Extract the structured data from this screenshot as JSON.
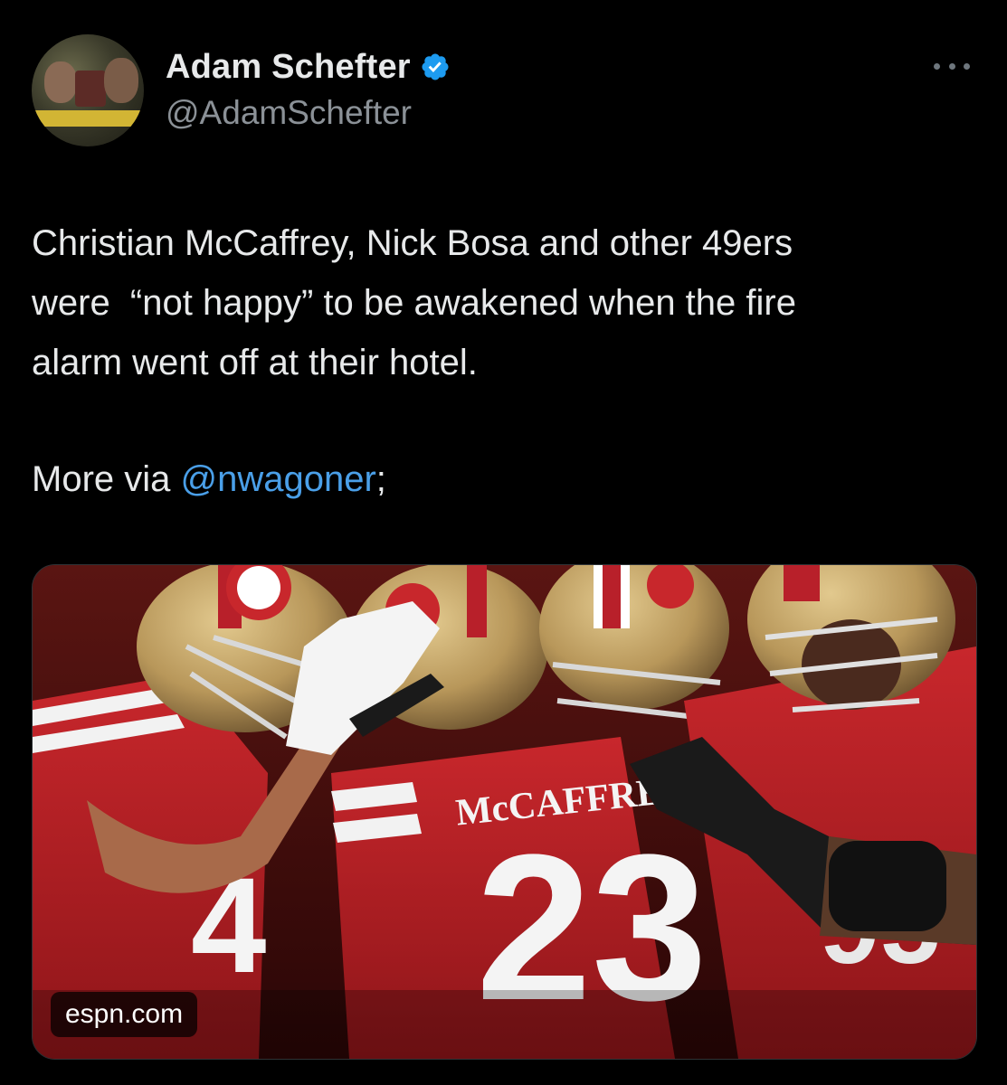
{
  "author": {
    "display_name": "Adam Schefter",
    "handle": "@AdamSchefter",
    "verified_icon": "verified-badge-icon",
    "avatar_icon": "profile-avatar"
  },
  "menu": {
    "icon": "more-options-icon"
  },
  "tweet": {
    "text": "Christian McCaffrey, Nick Bosa and other 49ers\nwere  “not happy” to be awakened when the fire\nalarm went off at their hotel.",
    "more_prefix": "More via ",
    "mention": "@nwagoner",
    "more_suffix": ";"
  },
  "media": {
    "jersey_name": "McCAFFREY",
    "jersey_number": "23",
    "source_label": "espn.com"
  },
  "colors": {
    "background": "#000000",
    "text": "#e7e9ea",
    "secondary_text": "#8b9197",
    "link": "#4a9fe8",
    "verified": "#1d9bf0",
    "jersey_red": "#b51f24",
    "helmet_gold": "#b8975a"
  }
}
